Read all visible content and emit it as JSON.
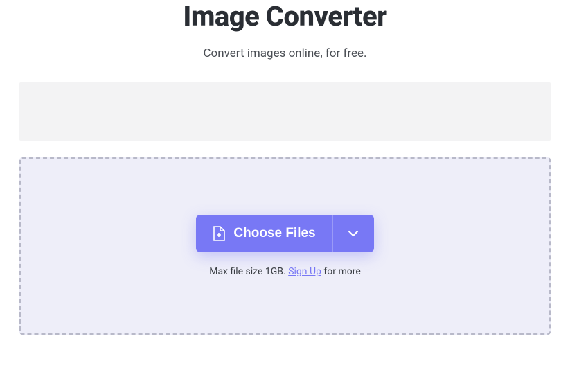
{
  "header": {
    "title": "Image Converter",
    "subtitle": "Convert images online, for free."
  },
  "uploader": {
    "choose_label": "Choose Files",
    "hint_prefix": "Max file size 1GB. ",
    "signup_label": "Sign Up",
    "hint_suffix": " for more"
  }
}
